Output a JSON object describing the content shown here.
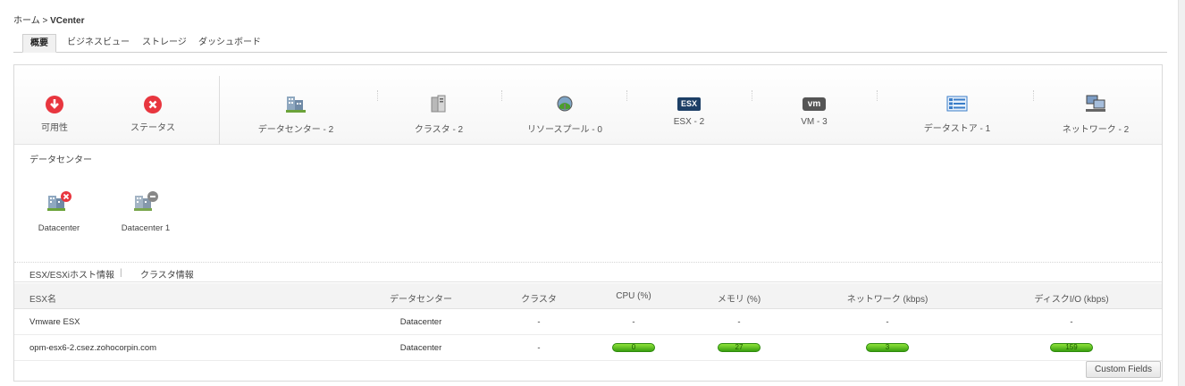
{
  "breadcrumb": {
    "home": "ホーム",
    "separator": " > ",
    "current": "VCenter"
  },
  "tabs": [
    {
      "label": "概要",
      "active": true
    },
    {
      "label": "ビジネスビュー",
      "active": false
    },
    {
      "label": "ストレージ",
      "active": false
    },
    {
      "label": "ダッシュボード",
      "active": false
    }
  ],
  "summary": {
    "availability": {
      "label": "可用性",
      "icon": "down-arrow-alert-icon",
      "color": "#e8363f"
    },
    "status": {
      "label": "ステータス",
      "icon": "x-circle-icon",
      "color": "#e8363f"
    },
    "inventory": [
      {
        "label": "データセンター - 2",
        "icon": "datacenter-icon"
      },
      {
        "label": "クラスタ - 2",
        "icon": "cluster-icon"
      },
      {
        "label": "リソースプール - 0",
        "icon": "resource-pool-icon"
      },
      {
        "label": "ESX - 2",
        "icon": "esx-icon",
        "badge": "ESX"
      },
      {
        "label": "VM - 3",
        "icon": "vm-icon",
        "badge": "vm"
      },
      {
        "label": "データストア - 1",
        "icon": "datastore-icon"
      },
      {
        "label": "ネットワーク - 2",
        "icon": "network-icon"
      }
    ]
  },
  "datacenters": {
    "title": "データセンター",
    "items": [
      {
        "name": "Datacenter",
        "status_icon": "critical-x-icon"
      },
      {
        "name": "Datacenter 1",
        "status_icon": "unmanaged-minus-icon"
      }
    ]
  },
  "subtabs": [
    "ESX/ESXiホスト情報",
    "クラスタ情報"
  ],
  "table": {
    "columns": [
      "ESX名",
      "データセンター",
      "クラスタ",
      "CPU (%)",
      "メモリ (%)",
      "ネットワーク (kbps)",
      "ディスクI/O (kbps)"
    ],
    "rows": [
      {
        "name": "Vmware ESX",
        "datacenter": "Datacenter",
        "cluster": "-",
        "cpu": "-",
        "memory": "-",
        "network": "-",
        "disk": "-"
      },
      {
        "name": "opm-esx6-2.csez.zohocorpin.com",
        "datacenter": "Datacenter",
        "cluster": "-",
        "cpu": "0",
        "memory": "27",
        "network": "3",
        "disk": "159"
      }
    ]
  },
  "custom_fields_label": "Custom Fields",
  "colors": {
    "ok_bar": "#4caf1a",
    "critical": "#e8363f",
    "esx_badge": "#1d3f66"
  }
}
